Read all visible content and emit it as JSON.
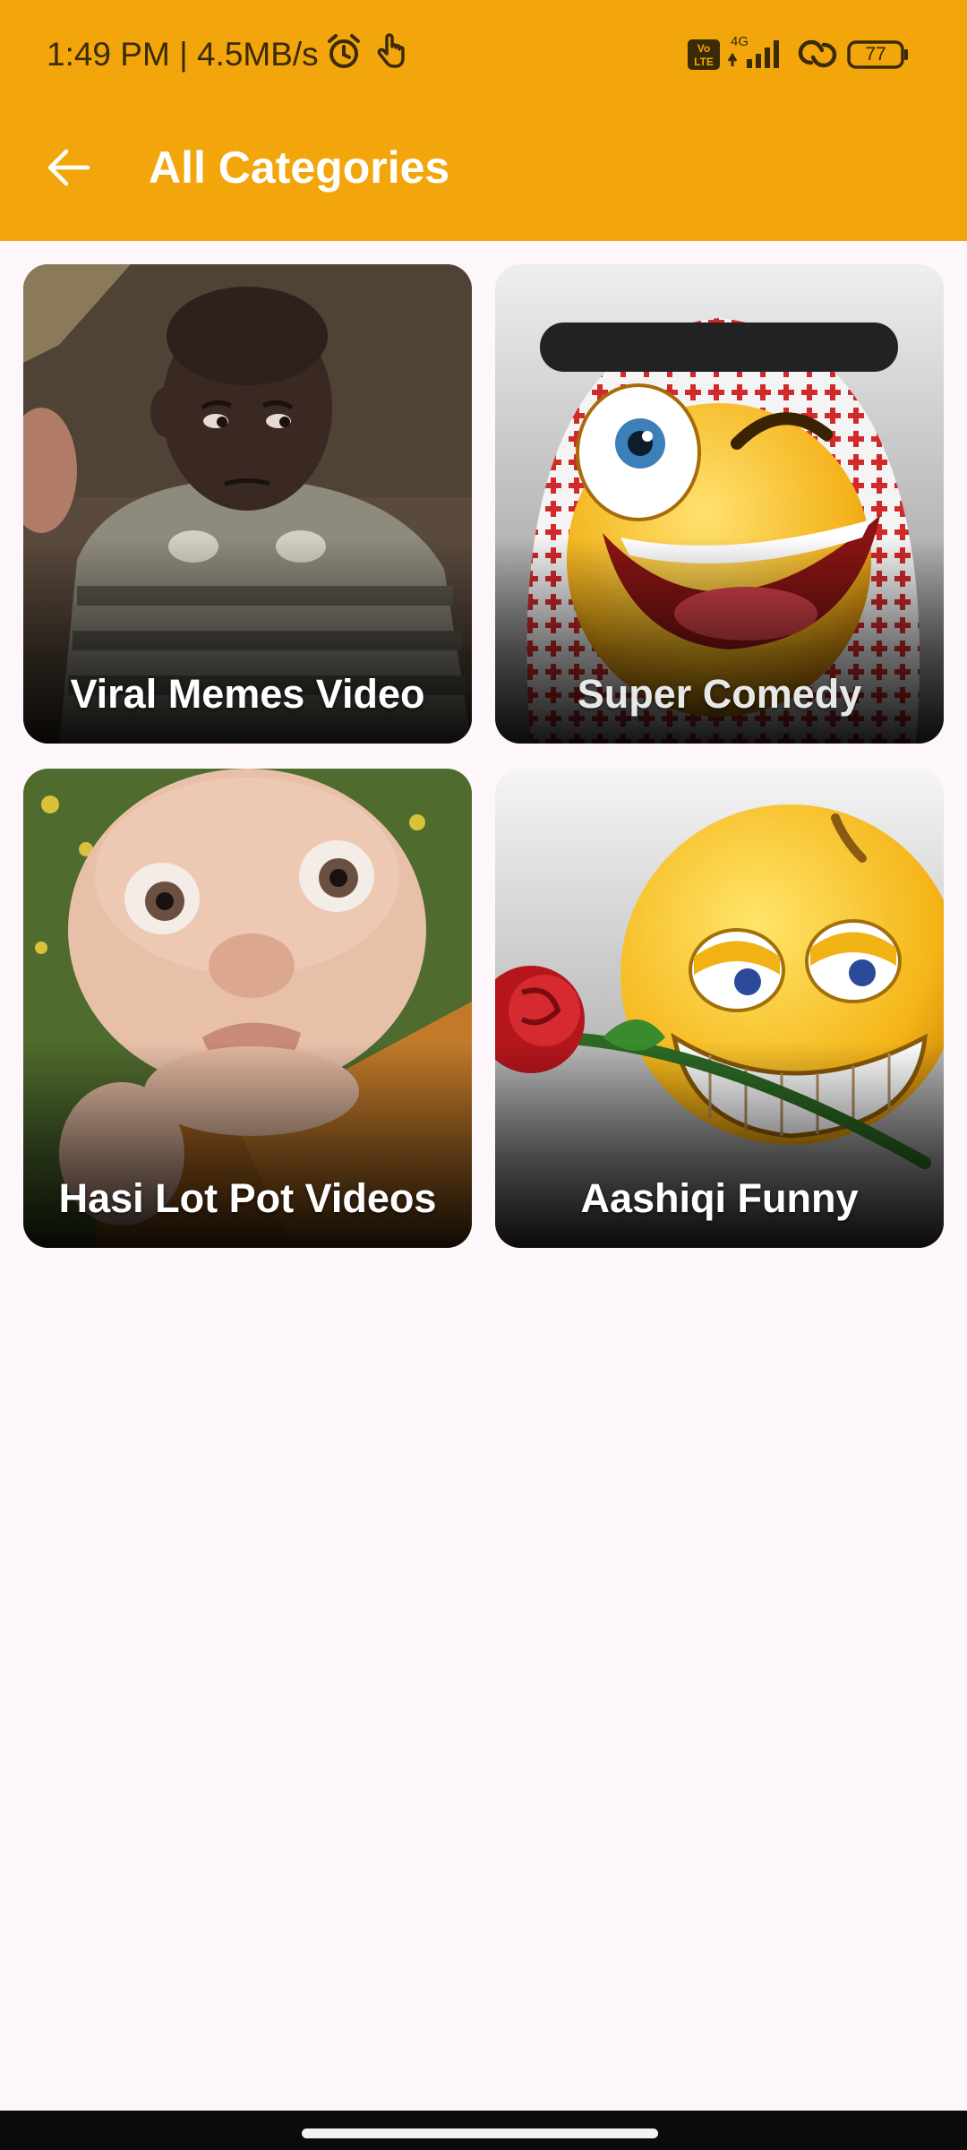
{
  "status_bar": {
    "time_speed": "1:49 PM | 4.5MB/s",
    "volte_label": "Vo LTE",
    "network_label": "4G",
    "battery_level": "77",
    "icons": [
      "alarm-icon",
      "hand-notification-icon",
      "volte-icon",
      "signal-icon",
      "hotspot-icon",
      "battery-icon"
    ]
  },
  "toolbar": {
    "title": "All Categories",
    "back_icon": "arrow-left-icon",
    "background_color": "#f2a60c"
  },
  "categories": [
    {
      "label": "Viral Memes Video",
      "image": "skeptical-child-photo"
    },
    {
      "label": "Super Comedy",
      "image": "winking-emoji-with-keffiyeh"
    },
    {
      "label": "Hasi Lot Pot Videos",
      "image": "funny-baby-monk-photo"
    },
    {
      "label": "Aashiqi Funny",
      "image": "emoji-with-rose-in-mouth"
    }
  ],
  "colors": {
    "page_background": "#fdf7fc",
    "card_label_text": "#ffffff",
    "nav_bar": "#0b0b0b"
  }
}
